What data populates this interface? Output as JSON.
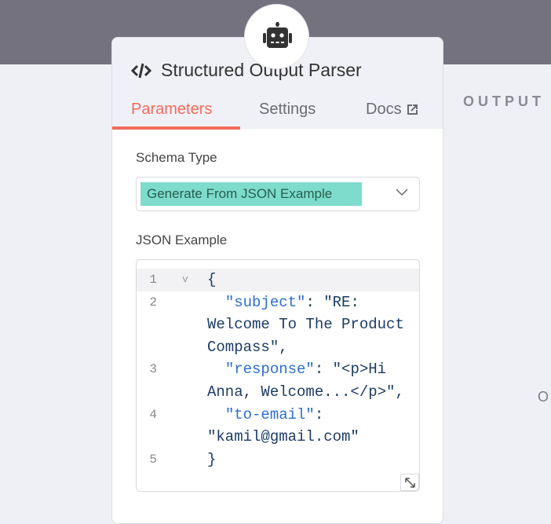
{
  "background": {
    "output_label": "OUTPUT",
    "partial_label": "O"
  },
  "node": {
    "icon": "robot-icon",
    "title": "Structured Output Parser"
  },
  "tabs": [
    {
      "label": "Parameters"
    },
    {
      "label": "Settings"
    },
    {
      "label": "Docs"
    }
  ],
  "params": {
    "schema_type_label": "Schema Type",
    "schema_type_value": "Generate From JSON Example",
    "json_example_label": "JSON Example",
    "code_lines": [
      {
        "num": "1",
        "key": "",
        "rest": "{"
      },
      {
        "num": "2",
        "key": "\"subject\"",
        "rest": ": \"RE: Welcome To The Product Compass\","
      },
      {
        "num": "3",
        "key": "\"response\"",
        "rest": ": \"<p>Hi Anna, Welcome...</p>\","
      },
      {
        "num": "4",
        "key": "\"to-email\"",
        "rest": ": \"kamil@gmail.com\""
      },
      {
        "num": "5",
        "key": "",
        "rest": "}"
      }
    ]
  },
  "colors": {
    "accent": "#f26b5b",
    "highlight": "#7ddccc",
    "key": "#2a6fd1"
  }
}
